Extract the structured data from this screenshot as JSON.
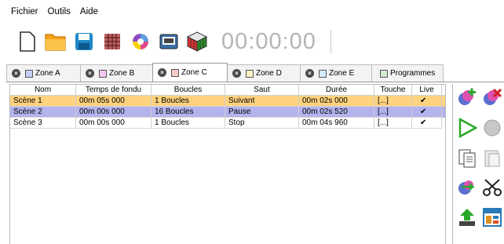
{
  "menu": {
    "items": [
      "Fichier",
      "Outils",
      "Aide"
    ]
  },
  "toolbar": {
    "timer": "00:00:00",
    "buttons": [
      "new-file-icon",
      "open-folder-icon",
      "save-icon",
      "grid-icon",
      "palette-icon",
      "device-icon",
      "cube-icon"
    ]
  },
  "tabs": [
    {
      "label": "Zone A",
      "color": "#c7cff7",
      "closable": true,
      "active": false
    },
    {
      "label": "Zone B",
      "color": "#f5c7f0",
      "closable": true,
      "active": false
    },
    {
      "label": "Zone C",
      "color": "#f9c8c8",
      "closable": true,
      "active": true
    },
    {
      "label": "Zone D",
      "color": "#fdf2c4",
      "closable": true,
      "active": false
    },
    {
      "label": "Zone E",
      "color": "#d6ecff",
      "closable": true,
      "active": false
    },
    {
      "label": "Programmes",
      "color": "#cfeccc",
      "closable": false,
      "active": false
    }
  ],
  "table": {
    "headers": [
      "Nom",
      "Temps de fondu",
      "Boucles",
      "Saut",
      "Durée",
      "Touche",
      "Live"
    ],
    "rows": [
      {
        "nom": "Scène 1",
        "temps": "00m 05s 000",
        "boucles": "1 Boucles",
        "saut": "Suivant",
        "duree": "00m 02s 000",
        "touche": "[...]",
        "live": "✔",
        "highlight": "#ffd27f"
      },
      {
        "nom": "Scène 2",
        "temps": "00m 00s 000",
        "boucles": "16 Boucles",
        "saut": "Pause",
        "duree": "00m 02s 520",
        "touche": "[...]",
        "live": "✔",
        "highlight": "#b3b3ee"
      },
      {
        "nom": "Scène 3",
        "temps": "00m 00s 000",
        "boucles": "1 Boucles",
        "saut": "Stop",
        "duree": "00m 04s 960",
        "touche": "[...]",
        "live": "✔",
        "highlight": ""
      }
    ]
  },
  "side_buttons": [
    "add-scene-icon",
    "delete-scene-icon",
    "play-icon",
    "record-icon",
    "copy-icon",
    "paste-icon",
    "shuffle-icon",
    "cut-icon",
    "upload-icon",
    "layout-icon"
  ]
}
